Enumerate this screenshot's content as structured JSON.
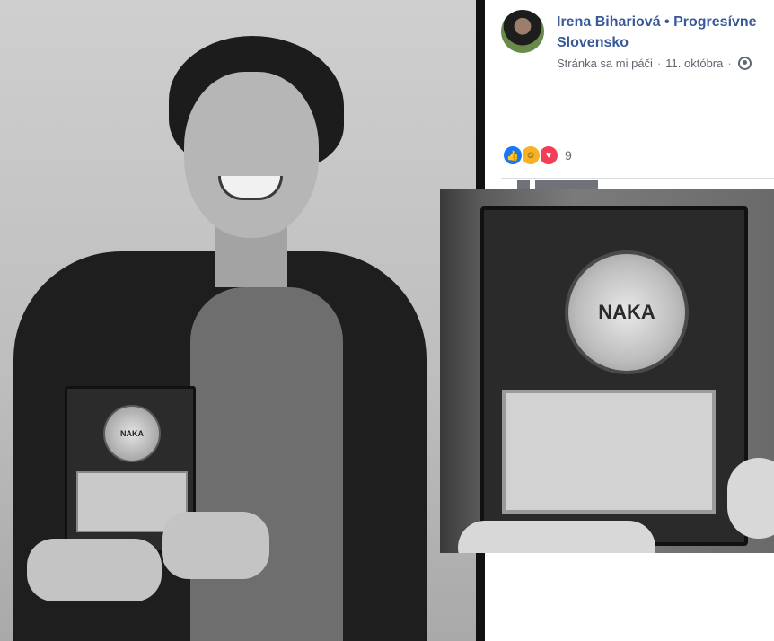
{
  "post": {
    "author": "Irena Bihariová • Progresívne Slovensko",
    "meta_page": "Stránka sa mi páči",
    "meta_date": "11. októbra",
    "separator": "·",
    "reactions_count": "9",
    "icons": {
      "audience": "globe-icon",
      "reaction_1": "like-icon",
      "reaction_2": "haha-icon",
      "reaction_3": "love-icon"
    }
  },
  "photo": {
    "plaque_logo": "NAKA",
    "zoom_logo": "NAKA"
  },
  "colors": {
    "author_link": "#385898",
    "meta_text": "#616770",
    "like": "#1877f2",
    "haha": "#f7b125",
    "love": "#f33e58"
  }
}
